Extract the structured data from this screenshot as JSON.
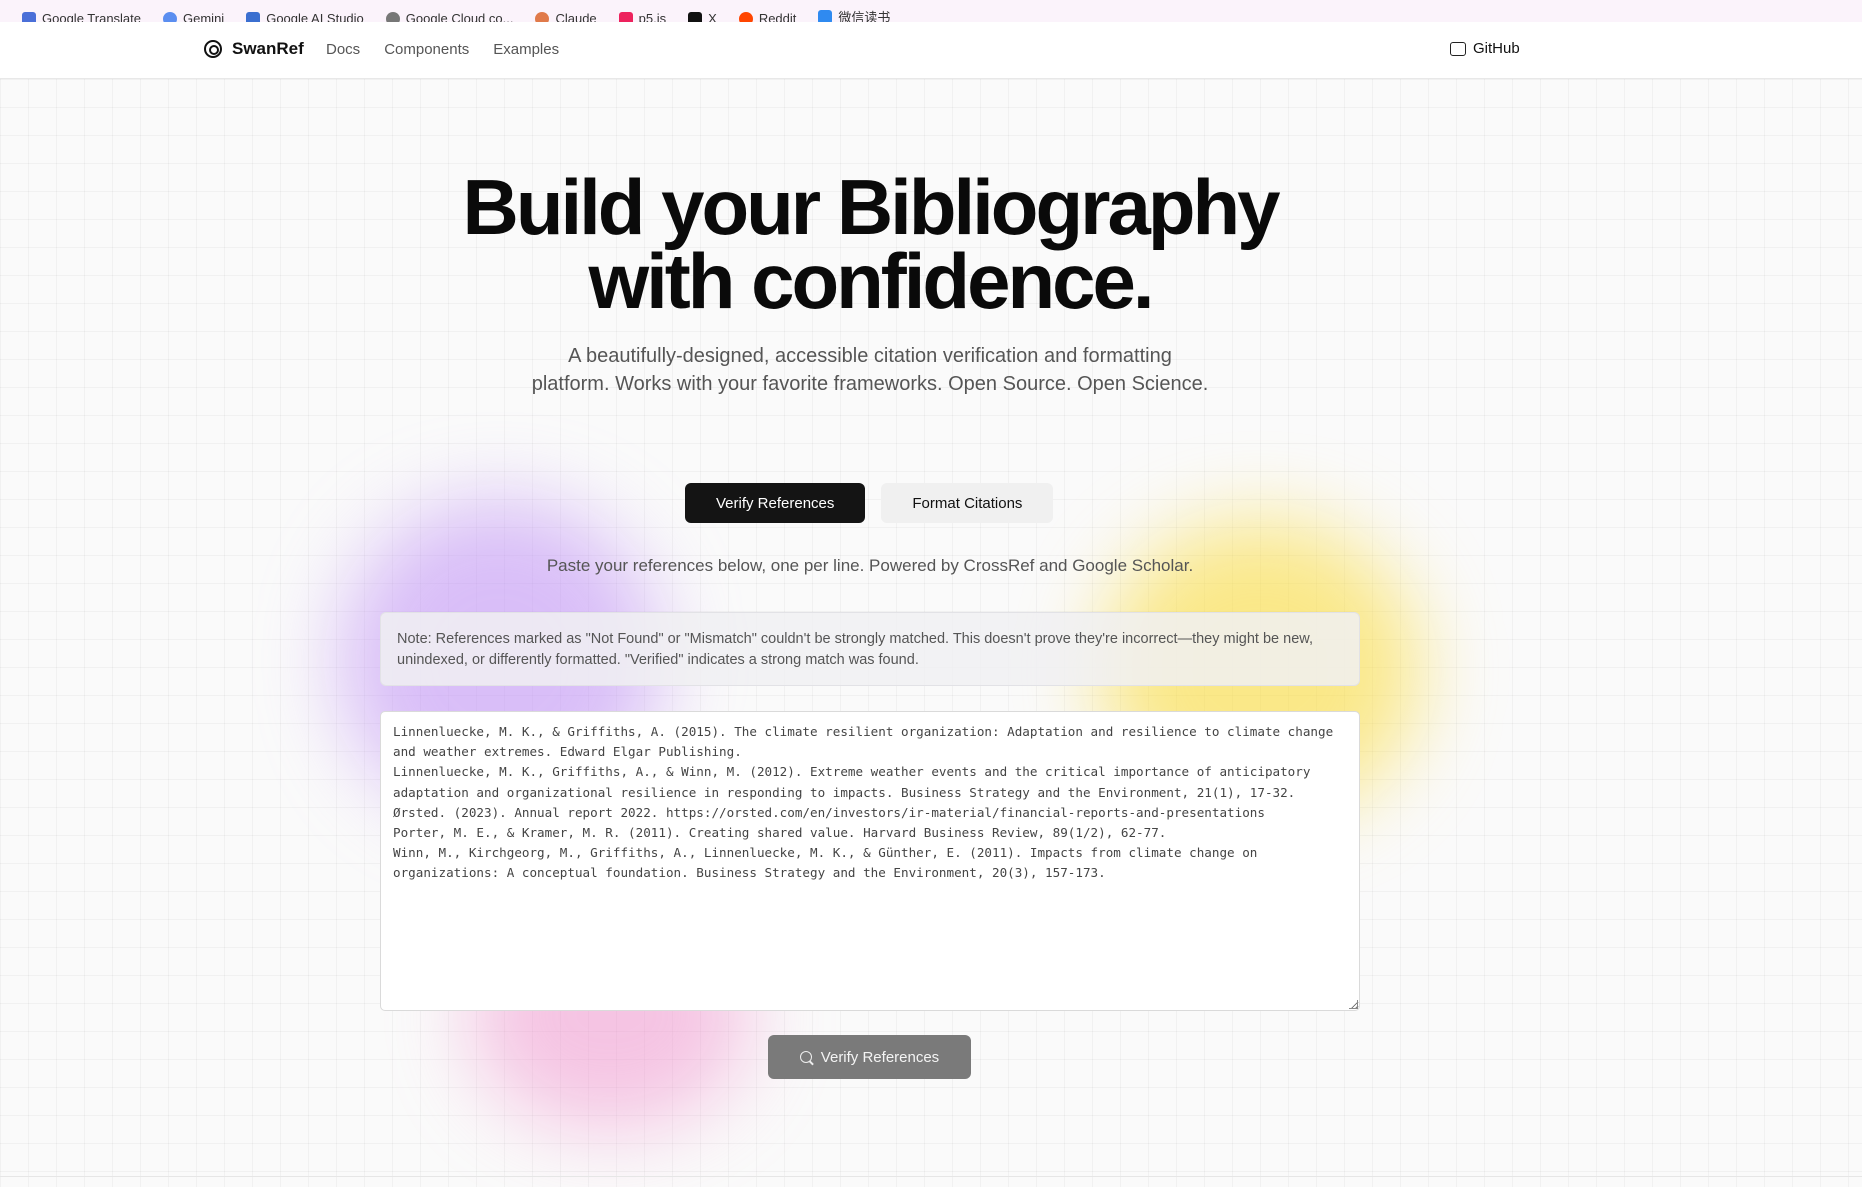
{
  "bookmarks": [
    {
      "label": "Google Translate",
      "icon": "translate-icon",
      "color": "#4a6fd8"
    },
    {
      "label": "Gemini",
      "icon": "gemini-icon",
      "color": "#5b8ef0"
    },
    {
      "label": "Google AI Studio",
      "icon": "ai-studio-icon",
      "color": "#3b6fd0"
    },
    {
      "label": "Google Cloud co...",
      "icon": "cloud-icon",
      "color": "#777777"
    },
    {
      "label": "Claude",
      "icon": "claude-icon",
      "color": "#e07a4a"
    },
    {
      "label": "p5.js",
      "icon": "p5-icon",
      "color": "#ed225d"
    },
    {
      "label": "X",
      "icon": "x-icon",
      "color": "#111111"
    },
    {
      "label": "Reddit",
      "icon": "reddit-icon",
      "color": "#ff4500"
    },
    {
      "label": "微信读书",
      "icon": "weread-icon",
      "color": "#2f8af0"
    }
  ],
  "nav": {
    "brand": "SwanRef",
    "links": [
      "Docs",
      "Components",
      "Examples"
    ],
    "github": "GitHub"
  },
  "hero": {
    "title_line1": "Build your Bibliography",
    "title_line2": "with confidence.",
    "subtitle": "A beautifully-designed, accessible citation verification and formatting platform. Works with your favorite frameworks. Open Source. Open Science."
  },
  "tabs": {
    "verify": "Verify References",
    "format": "Format Citations"
  },
  "helper_text": "Paste your references below, one per line. Powered by CrossRef and Google Scholar.",
  "note_text": "Note: References marked as \"Not Found\" or \"Mismatch\" couldn't be strongly matched. This doesn't prove they're incorrect—they might be new, unindexed, or differently formatted. \"Verified\" indicates a strong match was found.",
  "references_value": "Linnenluecke, M. K., & Griffiths, A. (2015). The climate resilient organization: Adaptation and resilience to climate change and weather extremes. Edward Elgar Publishing.\nLinnenluecke, M. K., Griffiths, A., & Winn, M. (2012). Extreme weather events and the critical importance of anticipatory adaptation and organizational resilience in responding to impacts. Business Strategy and the Environment, 21(1), 17-32.\nØrsted. (2023). Annual report 2022. https://orsted.com/en/investors/ir-material/financial-reports-and-presentations\nPorter, M. E., & Kramer, M. R. (2011). Creating shared value. Harvard Business Review, 89(1/2), 62-77.\nWinn, M., Kirchgeorg, M., Griffiths, A., Linnenluecke, M. K., & Günther, E. (2011). Impacts from climate change on organizations: A conceptual foundation. Business Strategy and the Environment, 20(3), 157-173.",
  "verify_button": "Verify References"
}
